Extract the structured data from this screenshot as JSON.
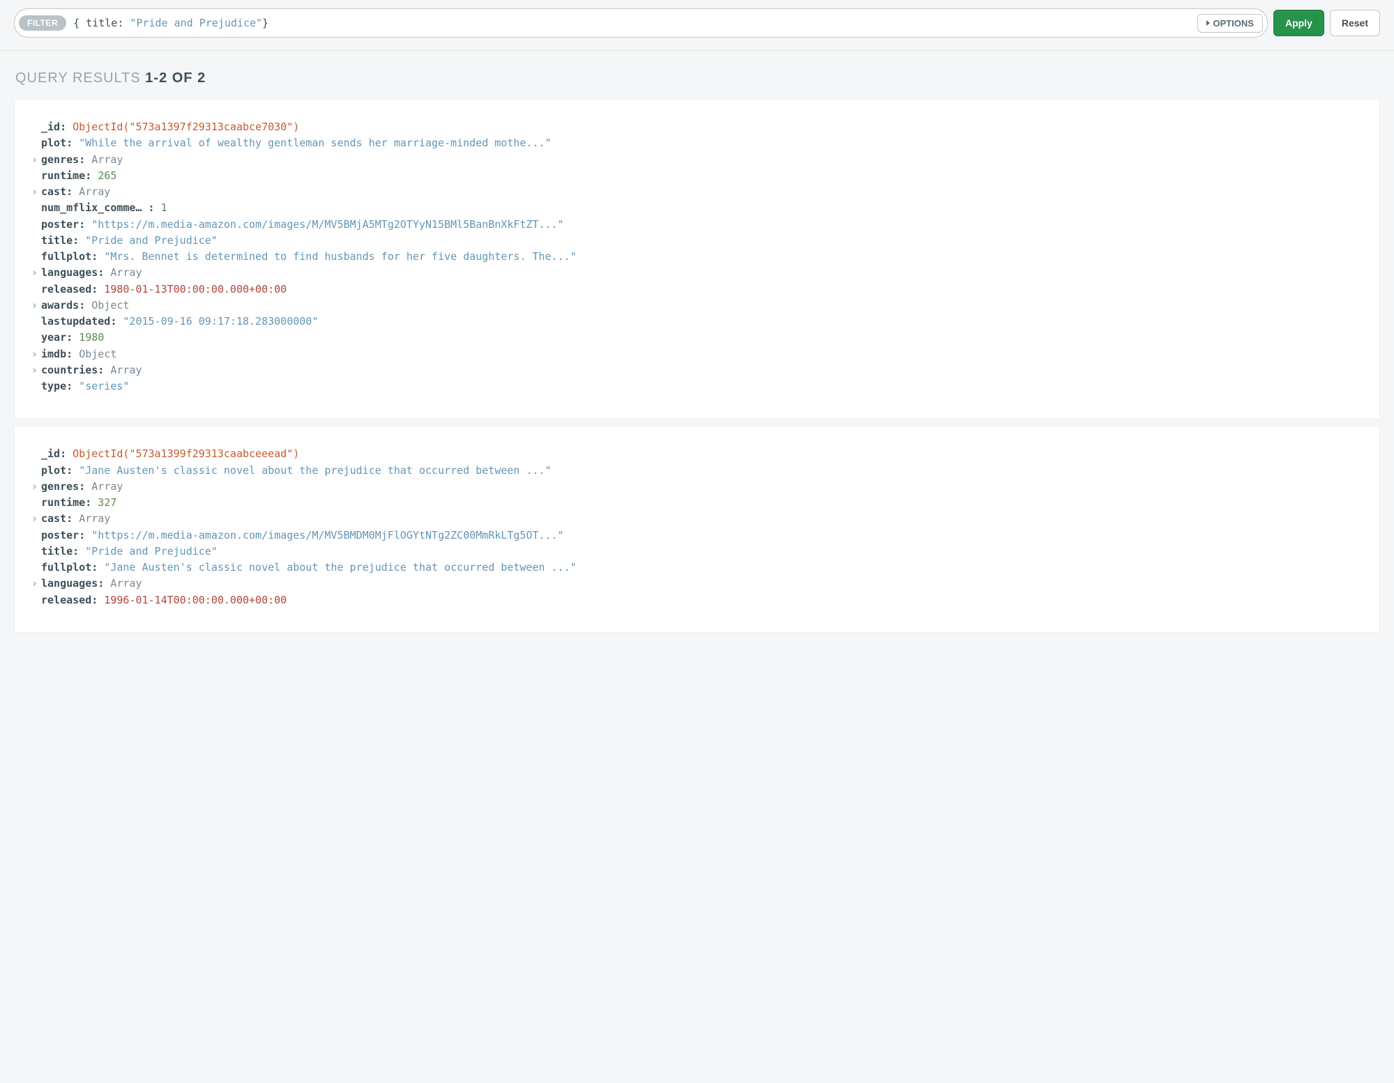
{
  "filter": {
    "badge": "FILTER",
    "query_open": "{",
    "query_key_prefix": " ",
    "query_key": "title:",
    "query_space": " ",
    "query_value": "\"Pride and Prejudice\"",
    "query_close": "}",
    "options_label": "OPTIONS",
    "apply_label": "Apply",
    "reset_label": "Reset"
  },
  "results": {
    "label": "QUERY RESULTS",
    "range": "1-2",
    "of": "OF",
    "total": "2"
  },
  "docs": [
    {
      "fields": [
        {
          "k": "_id",
          "v": "ObjectId(\"573a1397f29313caabce7030\")",
          "cls": "v-oid",
          "expandable": false
        },
        {
          "k": "plot",
          "v": "\"While the arrival of wealthy gentleman sends her marriage-minded mothe...\"",
          "cls": "v-str",
          "expandable": false
        },
        {
          "k": "genres",
          "v": "Array",
          "cls": "v-type",
          "expandable": true
        },
        {
          "k": "runtime",
          "v": "265",
          "cls": "v-num",
          "expandable": false
        },
        {
          "k": "cast",
          "v": "Array",
          "cls": "v-type",
          "expandable": true
        },
        {
          "k": "num_mflix_comme… ",
          "v": "1",
          "cls": "v-num",
          "expandable": false
        },
        {
          "k": "poster",
          "v": "\"https://m.media-amazon.com/images/M/MV5BMjA5MTg2OTYyN15BMl5BanBnXkFtZT...\"",
          "cls": "v-str",
          "expandable": false
        },
        {
          "k": "title",
          "v": "\"Pride and Prejudice\"",
          "cls": "v-str",
          "expandable": false
        },
        {
          "k": "fullplot",
          "v": "\"Mrs. Bennet is determined to find husbands for her five daughters. The...\"",
          "cls": "v-str",
          "expandable": false
        },
        {
          "k": "languages",
          "v": "Array",
          "cls": "v-type",
          "expandable": true
        },
        {
          "k": "released",
          "v": "1980-01-13T00:00:00.000+00:00",
          "cls": "v-date",
          "expandable": false
        },
        {
          "k": "awards",
          "v": "Object",
          "cls": "v-type",
          "expandable": true
        },
        {
          "k": "lastupdated",
          "v": "\"2015-09-16 09:17:18.283000000\"",
          "cls": "v-str",
          "expandable": false
        },
        {
          "k": "year",
          "v": "1980",
          "cls": "v-num",
          "expandable": false
        },
        {
          "k": "imdb",
          "v": "Object",
          "cls": "v-type",
          "expandable": true
        },
        {
          "k": "countries",
          "v": "Array",
          "cls": "v-type",
          "expandable": true
        },
        {
          "k": "type",
          "v": "\"series\"",
          "cls": "v-str",
          "expandable": false
        }
      ]
    },
    {
      "fields": [
        {
          "k": "_id",
          "v": "ObjectId(\"573a1399f29313caabceeead\")",
          "cls": "v-oid",
          "expandable": false
        },
        {
          "k": "plot",
          "v": "\"Jane Austen's classic novel about the prejudice that occurred between ...\"",
          "cls": "v-str",
          "expandable": false
        },
        {
          "k": "genres",
          "v": "Array",
          "cls": "v-type",
          "expandable": true
        },
        {
          "k": "runtime",
          "v": "327",
          "cls": "v-num",
          "expandable": false
        },
        {
          "k": "cast",
          "v": "Array",
          "cls": "v-type",
          "expandable": true
        },
        {
          "k": "poster",
          "v": "\"https://m.media-amazon.com/images/M/MV5BMDM0MjFlOGYtNTg2ZC00MmRkLTg5OT...\"",
          "cls": "v-str",
          "expandable": false
        },
        {
          "k": "title",
          "v": "\"Pride and Prejudice\"",
          "cls": "v-str",
          "expandable": false
        },
        {
          "k": "fullplot",
          "v": "\"Jane Austen's classic novel about the prejudice that occurred between ...\"",
          "cls": "v-str",
          "expandable": false
        },
        {
          "k": "languages",
          "v": "Array",
          "cls": "v-type",
          "expandable": true
        },
        {
          "k": "released",
          "v": "1996-01-14T00:00:00.000+00:00",
          "cls": "v-date",
          "expandable": false
        }
      ]
    }
  ]
}
